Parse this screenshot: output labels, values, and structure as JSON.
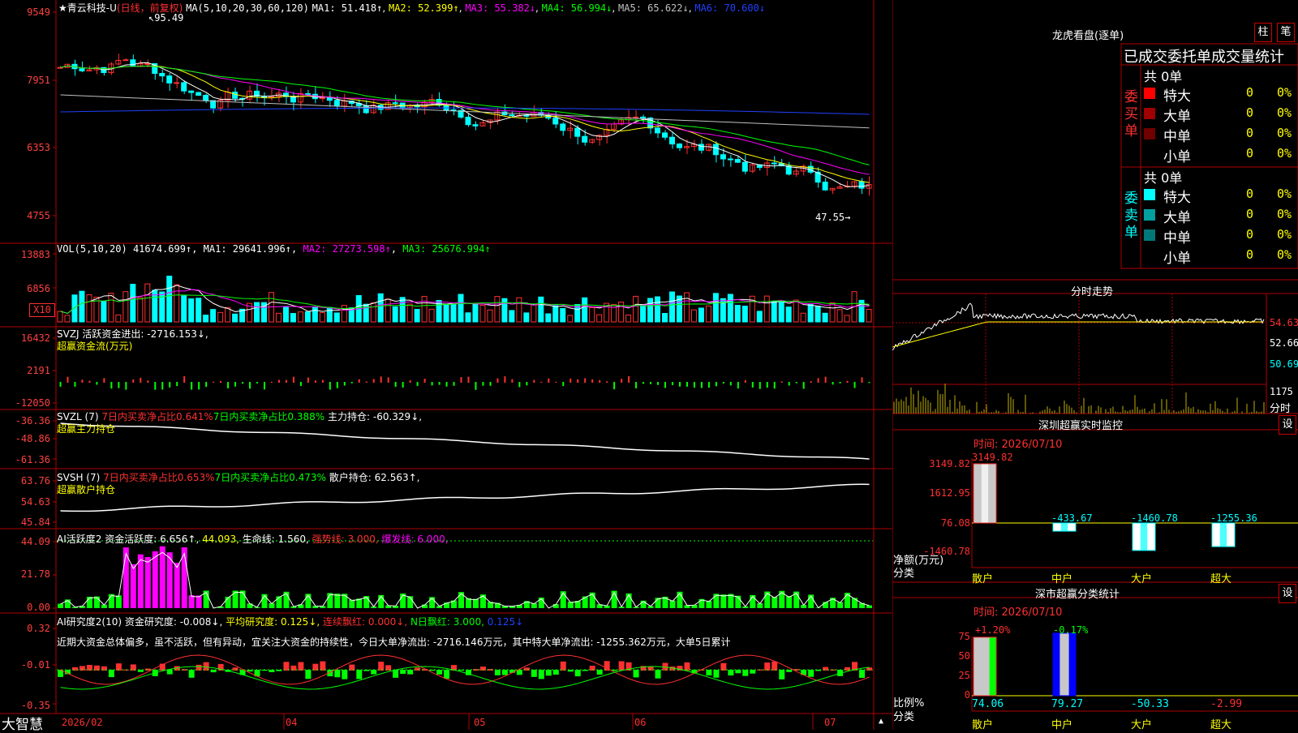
{
  "brand": {
    "label": "大智慧",
    "color": "#ffffff"
  },
  "stock": {
    "title": "青云科技-U",
    "period": "(日线，前复权)",
    "star": "★",
    "ma_label": "MA(5,10,20,30,60,120)",
    "ma": [
      {
        "label": "MA1: 51.418↑",
        "color": "#ffffff"
      },
      {
        "label": "MA2: 52.399↑",
        "color": "#ffff00"
      },
      {
        "label": "MA3: 55.382↓",
        "color": "#ff00ff"
      },
      {
        "label": "MA4: 56.994↓",
        "color": "#00ff00"
      },
      {
        "label": "MA5: 65.622↓",
        "color": "#c0c0c0"
      },
      {
        "label": "MA6: 70.600↓",
        "color": "#2040ff"
      }
    ],
    "high_marker": "95.49",
    "low_marker": "47.55",
    "price_ticks": [
      "9549",
      "7951",
      "6353",
      "4755"
    ]
  },
  "volume": {
    "label": "VOL(5,10,20)",
    "value": "41674.699↑",
    "ma": [
      {
        "label": "MA1: 29641.996↑",
        "color": "#ffffff"
      },
      {
        "label": "MA2: 27273.598↑",
        "color": "#ff00ff"
      },
      {
        "label": "MA3: 25676.994↑",
        "color": "#00ff00"
      }
    ],
    "ticks": [
      "13883",
      "6856"
    ],
    "unit": "X10"
  },
  "svzj": {
    "label": "SVZJ  活跃资金进出: -2716.153↓,",
    "subtitle": "超赢资金流(万元)",
    "ticks": [
      "16432",
      "2191",
      "-12050"
    ]
  },
  "svzl": {
    "label": "SVZL (7)",
    "p1": "7日内买卖净占比0.641%",
    "p2": "7日内买卖净占比0.388%",
    "p3": "主力持仓: -60.329↓,",
    "subtitle": "超赢主力持仓",
    "ticks": [
      "-36.36",
      "-48.86",
      "-61.36"
    ]
  },
  "svsh": {
    "label": "SVSH (7)",
    "p1": "7日内买卖净占比0.653%",
    "p2": "7日内买卖净占比0.473%",
    "p3": "散户持仓: 62.563↑,",
    "subtitle": "超赢散户持仓",
    "ticks": [
      "63.76",
      "54.63",
      "45.84"
    ]
  },
  "ai_active": {
    "label": "AI活跃度2",
    "p1": "资金活跃度: 6.656↑,",
    "p2": "44.093,",
    "p3": "生命线: 1.560,",
    "p4": "强势线: 3.000,",
    "p5": "爆发线: 6.000,",
    "ticks": [
      "44.09",
      "21.78",
      "0.00"
    ]
  },
  "ai_research": {
    "label": "AI研究度2(10)",
    "p1": "资金研究度: -0.008↓,",
    "p2": "平均研究度: 0.125↓,",
    "p3": "连续飘红: 0.000↓,",
    "p4": "N日飘红: 3.000,",
    "p5": "0.125↓",
    "comment": "近期大资金总体偏多，虽不活跃，但有异动，宜关注大资金的持续性，今日大单净流出: -2716.146万元，其中特大单净流出: -1255.362万元，大单5日累计",
    "ticks": [
      "0.32",
      "-0.01",
      "-0.35"
    ]
  },
  "x_axis": [
    "2026/02",
    "04",
    "05",
    "06",
    "07"
  ],
  "lhb": {
    "title": "龙虎看盘(逐单)",
    "btn_zhu": "柱",
    "btn_bi": "笔",
    "subtitle": "已成交委托单成交量统计",
    "buy_side": "委买单",
    "sell_side": "委卖单",
    "buy_total": "共 0单",
    "sell_total": "共 0单",
    "buy_rows": [
      {
        "label": "特大",
        "color": "#ff0000",
        "count": "0",
        "pct": "0%"
      },
      {
        "label": "大单",
        "color": "#a00000",
        "count": "0",
        "pct": "0%"
      },
      {
        "label": "中单",
        "color": "#700000",
        "count": "0",
        "pct": "0%"
      },
      {
        "label": "小单",
        "color": "",
        "count": "0",
        "pct": "0%"
      }
    ],
    "sell_rows": [
      {
        "label": "特大",
        "color": "#00ffff",
        "count": "0",
        "pct": "0%"
      },
      {
        "label": "大单",
        "color": "#00a0a0",
        "count": "0",
        "pct": "0%"
      },
      {
        "label": "中单",
        "color": "#007878",
        "count": "0",
        "pct": "0%"
      },
      {
        "label": "小单",
        "color": "",
        "count": "0",
        "pct": "0%"
      }
    ]
  },
  "fenshi": {
    "title": "分时走势",
    "ticks": [
      "54.63",
      "52.66",
      "50.69"
    ],
    "vol_tick": "1175",
    "unit_label": "分时"
  },
  "sz_monitor": {
    "title": "深圳超赢实时监控",
    "btn": "设",
    "time_label": "时间: 2026/07/10",
    "ticks": [
      "3149.82",
      "1612.95",
      "76.08",
      "-1460.78"
    ],
    "y_label": "净额(万元)",
    "x_label": "分类",
    "categories": [
      "散户",
      "中户",
      "大户",
      "超大"
    ],
    "values": [
      3149.82,
      -433.67,
      -1460.78,
      -1255.36
    ],
    "value_labels": [
      "3149.82",
      "-433.67",
      "-1460.78",
      "-1255.36"
    ]
  },
  "sz_class": {
    "title": "深市超赢分类统计",
    "btn": "设",
    "time_label": "时间: 2026/07/10",
    "ticks": [
      "75",
      "50",
      "25",
      "0"
    ],
    "y_label": "比例%",
    "x_label": "分类",
    "categories": [
      "散户",
      "中户",
      "大户",
      "超大"
    ],
    "top_labels": [
      "+1.20%",
      "-0.17%"
    ],
    "bottom_labels": [
      "74.06",
      "79.27",
      "-50.33",
      "-2.99"
    ],
    "values": [
      74.06,
      79.27,
      -50.33,
      -2.99
    ]
  }
}
